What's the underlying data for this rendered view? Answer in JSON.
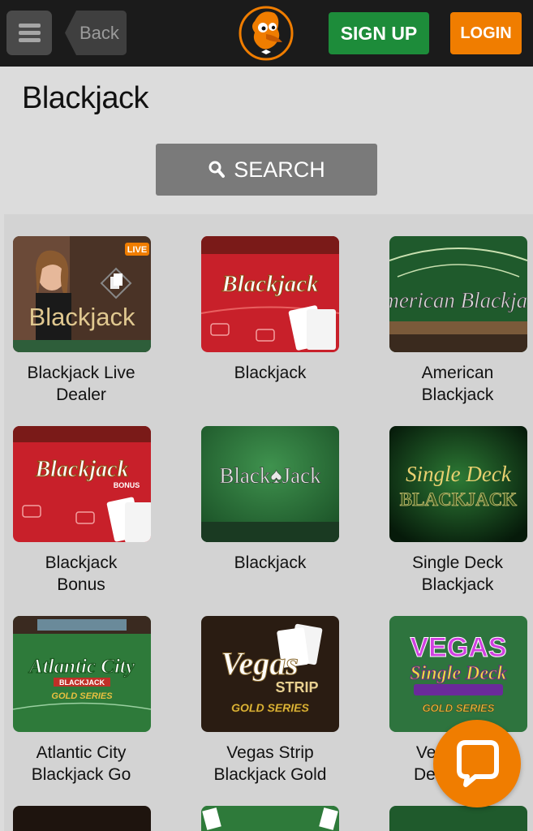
{
  "header": {
    "back_label": "Back",
    "signup_label": "SIGN UP",
    "login_label": "LOGIN",
    "colors": {
      "bar": "#1b1b1b",
      "signup": "#1d8c3a",
      "login": "#f07d00"
    }
  },
  "page": {
    "title": "Blackjack"
  },
  "search": {
    "label": "SEARCH"
  },
  "games": [
    {
      "label": "Blackjack Live Dealer",
      "line1": "Blackjack Live",
      "line2": "Dealer",
      "thumb_text": "Blackjack",
      "badge": "LIVE"
    },
    {
      "label": "Blackjack",
      "line1": "Blackjack",
      "line2": "",
      "thumb_text": "Blackjack"
    },
    {
      "label": "American Blackjack",
      "line1": "American",
      "line2": "Blackjack",
      "thumb_text": "American Blackjack"
    },
    {
      "label": "Blackjack Bonus",
      "line1": "Blackjack",
      "line2": "Bonus",
      "thumb_text": "Blackjack",
      "thumb_sub": "BONUS"
    },
    {
      "label": "Blackjack",
      "line1": "Blackjack",
      "line2": "",
      "thumb_text": "Black♠Jack"
    },
    {
      "label": "Single Deck Blackjack",
      "line1": "Single Deck",
      "line2": "Blackjack",
      "thumb_text": "Single Deck",
      "thumb_sub": "BLACKJACK"
    },
    {
      "label": "Atlantic City Blackjack Go",
      "line1": "Atlantic City",
      "line2": "Blackjack Go",
      "thumb_text": "Atlantic City",
      "thumb_sub": "BLACKJACK",
      "thumb_sub2": "GOLD SERIES"
    },
    {
      "label": "Vegas Strip Blackjack Gold",
      "line1": "Vegas Strip",
      "line2": "Blackjack Gold",
      "thumb_text": "Vegas",
      "thumb_sub": "STRIP",
      "thumb_sub2": "GOLD SERIES"
    },
    {
      "label": "Veg Deci",
      "line1": "Veg",
      "line2": "Deci",
      "thumb_text": "VEGAS",
      "thumb_sub": "Single Deck",
      "thumb_sub2": "GOLD SERIES"
    }
  ],
  "icons": [
    "menu-icon",
    "back-arrow-icon",
    "logo-mascot-icon",
    "search-icon",
    "chat-icon"
  ]
}
